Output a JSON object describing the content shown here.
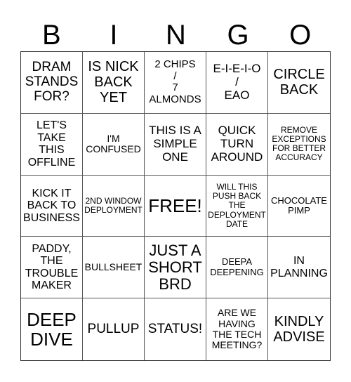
{
  "header": [
    "B",
    "I",
    "N",
    "G",
    "O"
  ],
  "cells": [
    "DRAM\nSTANDS\nFOR?",
    "IS NICK\nBACK\nYET",
    "2 CHIPS\n/\n7\nALMONDS",
    "E-I-E-I-O\n/\nEAO",
    "CIRCLE\nBACK",
    "LET'S\nTAKE\nTHIS\nOFFLINE",
    "I'M\nCONFUSED",
    "THIS IS A\nSIMPLE\nONE",
    "QUICK\nTURN\nAROUND",
    "REMOVE\nEXCEPTIONS\nFOR BETTER\nACCURACY",
    "KICK IT\nBACK TO\nBUSINESS",
    "2ND WINDOW\nDEPLOYMENT",
    "FREE!",
    "WILL THIS\nPUSH BACK\nTHE\nDEPLOYMENT\nDATE",
    "CHOCOLATE\nPIMP",
    "PADDY,\nTHE\nTROUBLE\nMAKER",
    "BULLSHEET",
    "JUST A\nSHORT\nBRD",
    "DEEPA\nDEEPENING",
    "IN\nPLANNING",
    "DEEP\nDIVE",
    "PULLUP",
    "STATUS!",
    "ARE WE\nHAVING\nTHE TECH\nMEETING?",
    "KINDLY\nADVISE"
  ]
}
